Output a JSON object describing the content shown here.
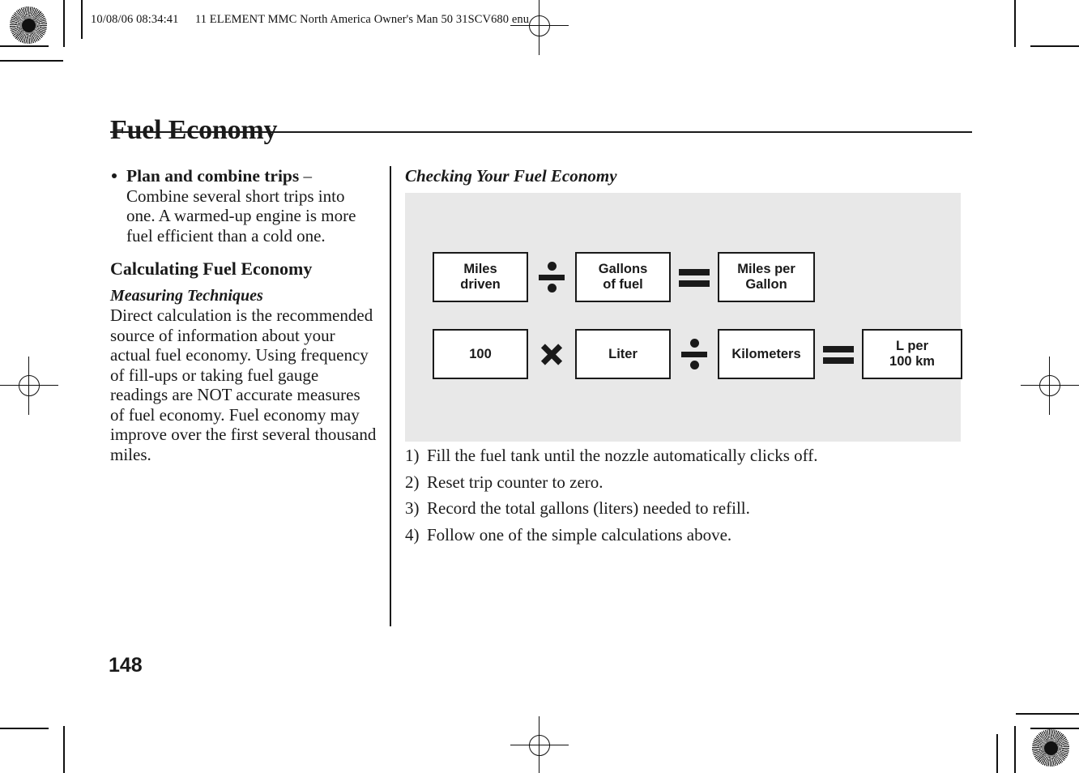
{
  "header": {
    "timestamp": "10/08/06 08:34:41",
    "document_id": "11 ELEMENT MMC North America Owner's Man 50 31SCV680 enu"
  },
  "page": {
    "title": "Fuel Economy",
    "number": "148"
  },
  "left_column": {
    "bullet": {
      "lead": "Plan and combine trips",
      "dash": "–",
      "body": "Combine several short trips into one. A warmed-up engine is more fuel efficient than a cold one."
    },
    "heading": "Calculating Fuel Economy",
    "subheading": "Measuring Techniques",
    "paragraph": "Direct calculation is the recommended source of information about your actual fuel economy. Using frequency of fill-ups or taking fuel gauge readings are NOT accurate measures of fuel economy. Fuel economy may improve over the first several thousand miles."
  },
  "right_column": {
    "heading": "Checking Your Fuel Economy",
    "formula_panel": {
      "background_color": "#e8e8e8",
      "rows": [
        {
          "id": "us-units",
          "items": [
            {
              "kind": "box",
              "text": "Miles\ndriven",
              "line1": "Miles",
              "line2": "driven"
            },
            {
              "kind": "operator",
              "symbol": "divide",
              "glyph": "÷"
            },
            {
              "kind": "box",
              "text": "Gallons\nof fuel",
              "line1": "Gallons",
              "line2": "of fuel"
            },
            {
              "kind": "operator",
              "symbol": "equals",
              "glyph": "="
            },
            {
              "kind": "box",
              "text": "Miles per\nGallon",
              "line1": "Miles per",
              "line2": "Gallon"
            }
          ]
        },
        {
          "id": "metric-units",
          "items": [
            {
              "kind": "box",
              "text": "100",
              "line1": "100",
              "line2": ""
            },
            {
              "kind": "operator",
              "symbol": "times",
              "glyph": "×"
            },
            {
              "kind": "box",
              "text": "Liter",
              "line1": "Liter",
              "line2": ""
            },
            {
              "kind": "operator",
              "symbol": "divide",
              "glyph": "÷"
            },
            {
              "kind": "box",
              "text": "Kilometers",
              "line1": "Kilometers",
              "line2": ""
            },
            {
              "kind": "operator",
              "symbol": "equals",
              "glyph": "="
            },
            {
              "kind": "box",
              "text": "L per\n100 km",
              "line1": "L per",
              "line2": "100 km"
            }
          ]
        }
      ]
    },
    "steps": [
      {
        "num": "1)",
        "text": "Fill the fuel tank until the nozzle automatically clicks off."
      },
      {
        "num": "2)",
        "text": "Reset trip counter to zero."
      },
      {
        "num": "3)",
        "text": "Record the total gallons (liters) needed to refill."
      },
      {
        "num": "4)",
        "text": "Follow one of the simple calculations above."
      }
    ]
  }
}
